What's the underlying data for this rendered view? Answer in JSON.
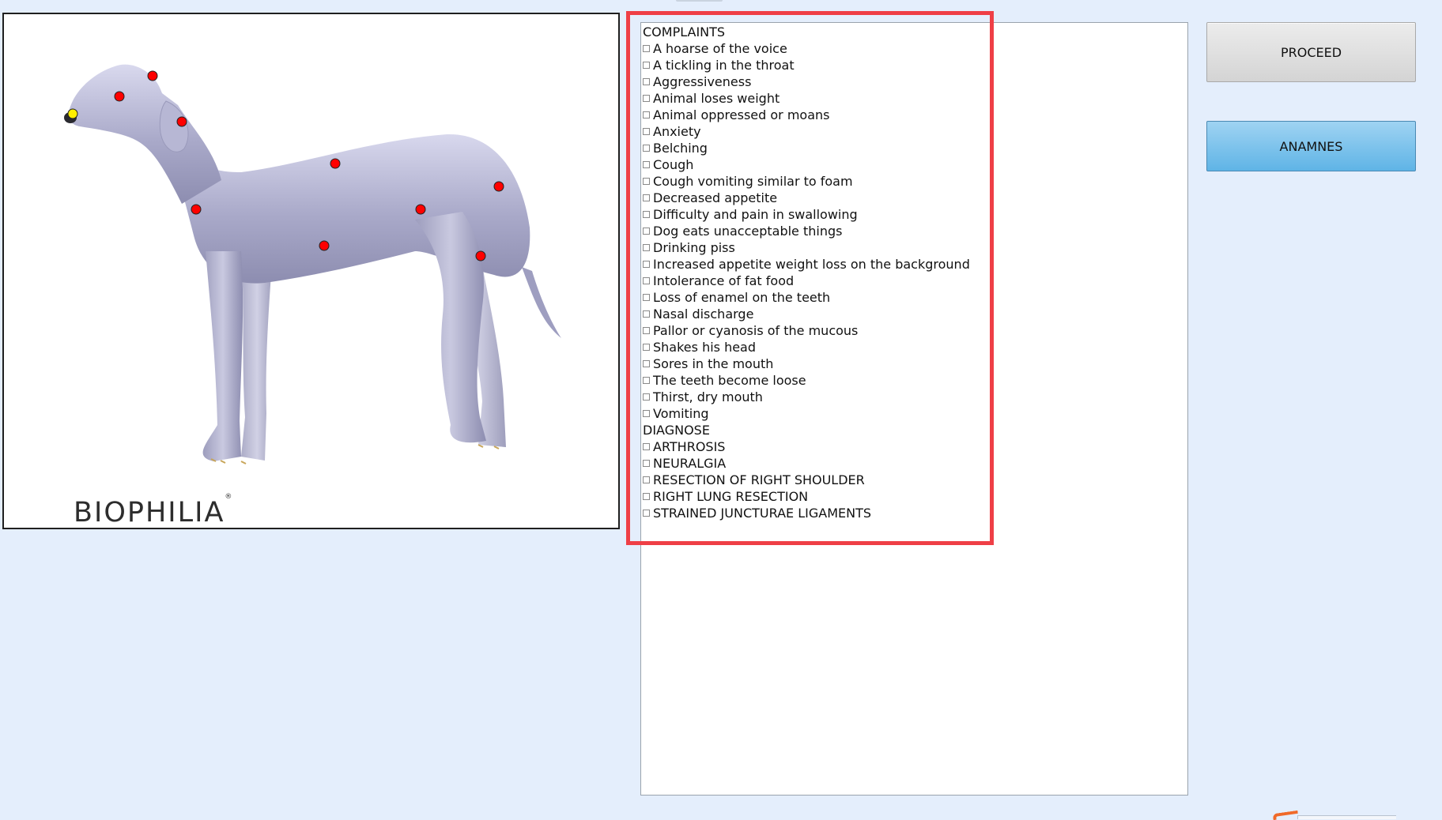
{
  "brand": {
    "name": "BIOPHILIA",
    "mark": "®"
  },
  "buttons": {
    "proceed": "PROCEED",
    "anamnes": "ANAMNES"
  },
  "colors": {
    "point_selected": "#ff0000",
    "point_active": "#ffee00",
    "highlight": "#ef3f46",
    "button_blue": "#5fb4e6",
    "background": "#e4eefc"
  },
  "body_points": {
    "red_count": 10,
    "yellow_count": 1
  },
  "list": {
    "complaints_heading": "COMPLAINTS",
    "complaints": [
      "A hoarse of  the  voice",
      "A tickling in the throat",
      "Aggressiveness",
      "Animal loses weight",
      "Animal oppressed or moans",
      "Anxiety",
      "Belching",
      "Cough",
      "Cough vomiting similar to foam",
      "Decreased appetite",
      "Difficulty  and pain in swallowing",
      "Dog eats unacceptable things",
      "Drinking piss",
      "Increased appetite weight loss on the background",
      "Intolerance of fat food",
      "Loss of enamel on the teeth",
      "Nasal discharge",
      "Pallor or cyanosis of the mucous",
      "Shakes his head",
      "Sores in the mouth",
      "The teeth become loose",
      "Thirst, dry mouth",
      "Vomiting"
    ],
    "diagnose_heading": "DIAGNOSE",
    "diagnoses": [
      "ARTHROSIS",
      "NEURALGIA",
      "RESECTION OF RIGHT SHOULDER",
      "RIGHT LUNG RESECTION",
      "STRAINED  JUNCTURAE  LIGAMENTS"
    ]
  }
}
